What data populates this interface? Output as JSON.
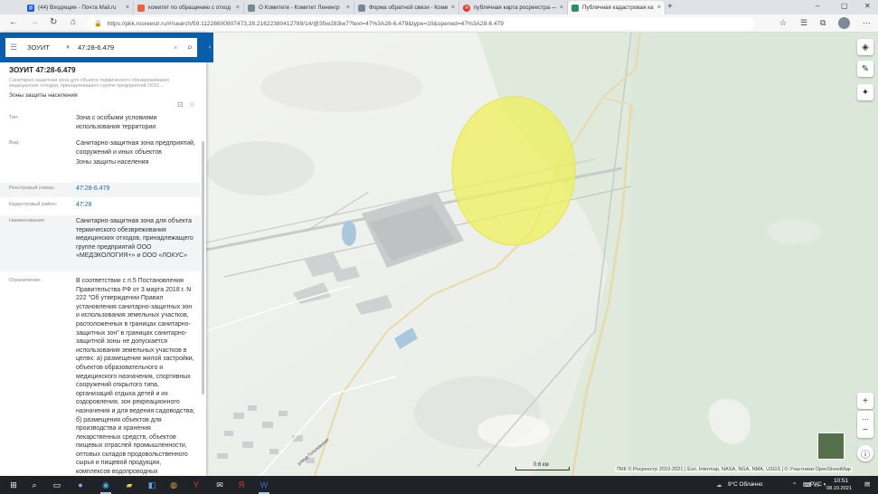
{
  "browser": {
    "tabs": [
      {
        "title": "(44) Входящие - Почта Mail.ru",
        "icon": "mail-icon",
        "color": "#1e5bc6"
      },
      {
        "title": "комитет по обращению с отход",
        "icon": "site-icon",
        "color": "#e8623a"
      },
      {
        "title": "О Комитете - Комитет Ленингр",
        "icon": "site-icon",
        "color": "#7a8792"
      },
      {
        "title": "Форма обратной связи - Комит",
        "icon": "site-icon",
        "color": "#7a8792"
      },
      {
        "title": "публичная карта росреестра — Я",
        "icon": "yandex-icon",
        "color": "#e03b2c"
      },
      {
        "title": "Публичная кадастровая карта",
        "icon": "rosreestr-icon",
        "color": "#2a8f6a"
      }
    ],
    "url": "https://pkk.rosreestr.ru/#/search/59.11228600907473,28.21622380412789/14/@35w283iw7?text=47%3A28-6.479&type=10&opened=47%3A28-6.479"
  },
  "search": {
    "category": "ЗОУИТ",
    "query": "47:28-6.479"
  },
  "object": {
    "title": "ЗОУИТ 47:28-6.479",
    "subtitle": "Санитарно-защитная зона для объекта термического обезвреживания медицинских отходов, принадлежащего группе предприятий ООО...",
    "kind": "Зоны защиты населения",
    "fields": [
      {
        "label": "Тип:",
        "value": "Зона с особыми условиями использования территории",
        "link": false,
        "shade": false
      },
      {
        "label": "Вид:",
        "value": "Санитарно-защитная зона предприятий, сооружений и иных объектов",
        "value2": "Зоны защиты населения",
        "link": false,
        "shade": false
      },
      {
        "label": "Реестровый номер:",
        "value": "47:28-6.479",
        "link": true,
        "shade": true
      },
      {
        "label": "Кадастровый район:",
        "value": "47:28",
        "link": true,
        "shade": false
      },
      {
        "label": "Наименование:",
        "value": "Санитарно-защитная зона для объекта термического обезвреживания медицинских отходов, принадлежащего группе предприятий ООО «МЕДЭКОЛОГИЯ+» и ООО «ЛОКУС»",
        "link": false,
        "shade": true
      },
      {
        "label": "Ограничение:",
        "value": "В соответствии с п.5 Постановления Правительства РФ от 3 марта 2018 г. N 222 \"Об утверждении Правил установления санитарно-защитных зон и использования земельных участков, расположенных в границах санитарно-защитных зон\" в границах санитарно-защитной зоны не допускается использования земельных участков в целях: а) размещения жилой застройки, объектов образовательного и медицинского назначения, спортивных сооружений открытого типа, организаций отдыха детей и их оздоровления, зон рекреационного назначения и для ведения садоводства; б) размещения объектов для производства и хранения лекарственных средств, объектов пищевых отраслей промышленности, оптовых складов продовольственного сырья и пищевой продукции, комплексов водопроводных",
        "link": false,
        "shade": false
      }
    ]
  },
  "map": {
    "scale_label": "0.6 км",
    "street_label": "улица Гоголевская",
    "attribution": "ПКК © Росреестр 2010-2021 | Esri, Intermap, NASA, NGA, NMA, USGS | © Участники OpenStreetMap",
    "zone_color": "#eef056",
    "zoom_in": "+",
    "zoom_out": "−"
  },
  "taskbar": {
    "weather": "9°C Облачно",
    "lang": "РУС",
    "time": "10:51",
    "date": "08.10.2021"
  }
}
